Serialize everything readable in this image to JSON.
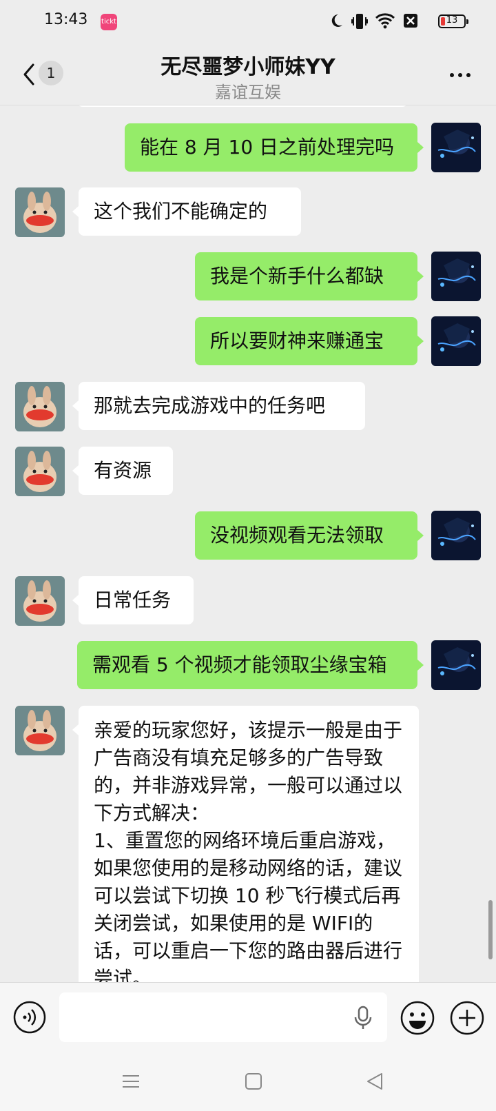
{
  "status_bar": {
    "time": "13:43",
    "app_badge_text": "tickt",
    "battery_level": "13",
    "icons": [
      "moon-icon",
      "vibrate-icon",
      "wifi-icon",
      "sim-off-icon",
      "battery-icon"
    ]
  },
  "header": {
    "unread_count": "1",
    "title": "无尽噩梦小师妹YY",
    "subtitle": "嘉谊互娱"
  },
  "messages": [
    {
      "side": "out",
      "text": "能在 8 月 10 日之前处理完吗"
    },
    {
      "side": "in",
      "text": "这个我们不能确定的"
    },
    {
      "side": "out",
      "text": "我是个新手什么都缺"
    },
    {
      "side": "out",
      "text": "所以要财神来赚通宝"
    },
    {
      "side": "in",
      "text": "那就去完成游戏中的任务吧"
    },
    {
      "side": "in",
      "text": "有资源"
    },
    {
      "side": "out",
      "text": "没视频观看无法领取"
    },
    {
      "side": "in",
      "text": "日常任务"
    },
    {
      "side": "out",
      "text": "需观看 5 个视频才能领取尘缘宝箱"
    },
    {
      "side": "in",
      "text": "亲爱的玩家您好，该提示一般是由于广告商没有填充足够多的广告导致的，并非游戏异常，一般可以通过以下方式解决：\n1、重置您的网络环境后重启游戏，如果您使用的是移动网络的话，建议可以尝试下切换 10 秒飞行模式后再关闭尝试，如果使用的是 WIFI的话，可以重启一下您的路由器后进行尝试。"
    }
  ],
  "input_bar": {
    "placeholder": ""
  },
  "colors": {
    "outgoing_bubble": "#95ec69",
    "incoming_bubble": "#ffffff",
    "background": "#ededed"
  }
}
